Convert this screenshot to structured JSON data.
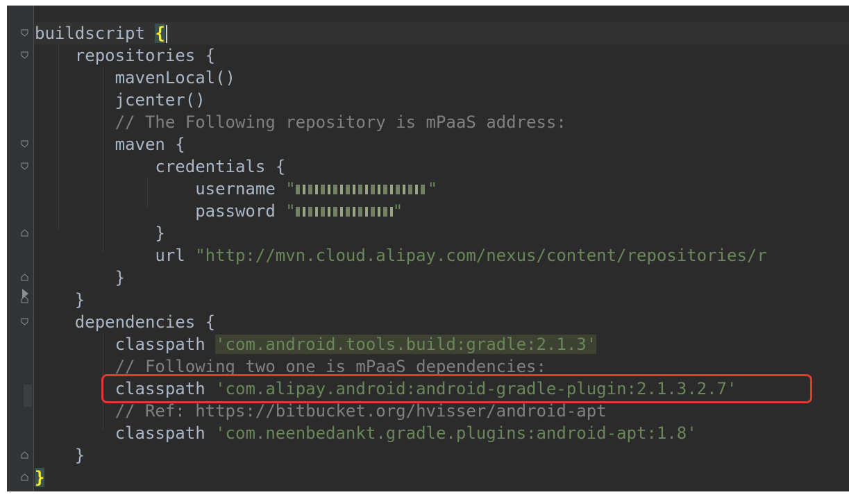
{
  "editor": {
    "lines": [
      {
        "parts": [
          {
            "t": "buildscript ",
            "c": "kw"
          },
          {
            "t": "{",
            "c": "brace-match"
          }
        ]
      },
      {
        "parts": [
          {
            "t": "    repositories {",
            "c": "kw"
          }
        ]
      },
      {
        "parts": [
          {
            "t": "        mavenLocal()",
            "c": "kw"
          }
        ]
      },
      {
        "parts": [
          {
            "t": "        jcenter()",
            "c": "kw"
          }
        ]
      },
      {
        "parts": [
          {
            "t": "        // The Following repository is mPaaS address:",
            "c": "comment"
          }
        ]
      },
      {
        "parts": [
          {
            "t": "        maven {",
            "c": "kw"
          }
        ]
      },
      {
        "parts": [
          {
            "t": "            credentials {",
            "c": "kw"
          }
        ]
      },
      {
        "parts": [
          {
            "t": "                username ",
            "c": "kw"
          },
          {
            "t": "\"",
            "c": "str"
          },
          {
            "blur": "username_redacted"
          },
          {
            "t": "\"",
            "c": "str"
          }
        ]
      },
      {
        "parts": [
          {
            "t": "                password ",
            "c": "kw"
          },
          {
            "t": "\"",
            "c": "str"
          },
          {
            "blur": "password_redacted"
          },
          {
            "t": "\"",
            "c": "str"
          }
        ]
      },
      {
        "parts": [
          {
            "t": "            }",
            "c": "kw"
          }
        ]
      },
      {
        "parts": [
          {
            "t": "            url ",
            "c": "kw"
          },
          {
            "t": "\"http://mvn.cloud.alipay.com/nexus/content/repositories/r",
            "c": "str"
          }
        ]
      },
      {
        "parts": [
          {
            "t": "        }",
            "c": "kw"
          }
        ]
      },
      {
        "parts": [
          {
            "t": "    }",
            "c": "kw"
          }
        ]
      },
      {
        "parts": [
          {
            "t": "    dependencies {",
            "c": "kw"
          }
        ]
      },
      {
        "parts": [
          {
            "t": "        classpath ",
            "c": "kw"
          },
          {
            "t": "'com.android.tools.build:gradle:2.1.3'",
            "c": "str-hl"
          }
        ]
      },
      {
        "parts": [
          {
            "t": "        // Following two one is mPaaS dependencies:",
            "c": "comment"
          }
        ]
      },
      {
        "parts": [
          {
            "t": "        classpath ",
            "c": "kw"
          },
          {
            "t": "'com.alipay.android:android-gradle-plugin:2.1.3.2.7'",
            "c": "str"
          }
        ]
      },
      {
        "parts": [
          {
            "t": "        // Ref: https://bitbucket.org/hvisser/android-apt",
            "c": "comment"
          }
        ]
      },
      {
        "parts": [
          {
            "t": "        classpath ",
            "c": "kw"
          },
          {
            "t": "'com.neenbedankt.gradle.plugins:android-apt:1.8'",
            "c": "str"
          }
        ]
      },
      {
        "parts": [
          {
            "t": "    }",
            "c": "kw"
          }
        ]
      },
      {
        "parts": [
          {
            "t": "}",
            "c": "brace-match"
          }
        ]
      }
    ]
  },
  "colors": {
    "background": "#2b2b2b",
    "gutter": "#313335",
    "text": "#a9b7c6",
    "comment": "#808080",
    "string": "#6a8759",
    "brace_match": "#ffef28",
    "annotation_box": "#e5382f"
  },
  "icons": [
    "fold-open-icon",
    "fold-close-icon",
    "bookmark-arrow-icon"
  ]
}
